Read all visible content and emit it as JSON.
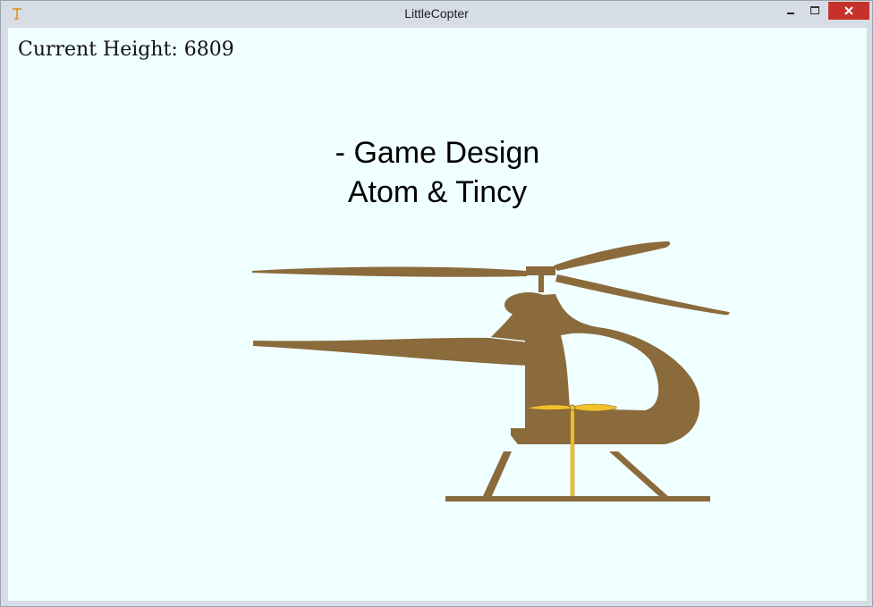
{
  "window": {
    "title": "LittleCopter",
    "icon": "copter-app-icon"
  },
  "hud": {
    "current_height_label": "Current Height: 6809"
  },
  "credits": {
    "line1": "- Game Design",
    "line2": "Atom & Tincy"
  },
  "colors": {
    "background": "#f0ffff",
    "copter_body": "#8b6a3c",
    "tail_rotor": "#f2c12e",
    "close_button": "#c7312b"
  }
}
